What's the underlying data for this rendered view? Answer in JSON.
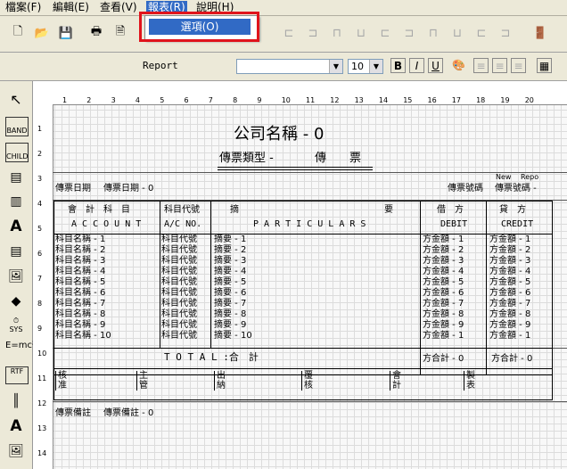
{
  "menu": [
    "檔案(F)",
    "編輯(E)",
    "查看(V)",
    "報表(R)",
    "說明(H)"
  ],
  "dropdown_option": "選項(O)",
  "toolbar2": {
    "report_label": "Report",
    "font_size": "10",
    "bold": "B",
    "italic": "I",
    "underline": "U"
  },
  "tools": [
    "BAND",
    "CHILD",
    "SYS",
    "E=mc²",
    "RTF"
  ],
  "ruler_h": [
    "1",
    "2",
    "3",
    "4",
    "5",
    "6",
    "7",
    "8",
    "9",
    "10",
    "11",
    "12",
    "13",
    "14",
    "15",
    "16",
    "17",
    "18",
    "19",
    "20"
  ],
  "ruler_v": [
    "1",
    "2",
    "3",
    "4",
    "5",
    "6",
    "7",
    "8",
    "9",
    "10",
    "11",
    "12",
    "13",
    "14"
  ],
  "report": {
    "company": "公司名稱 - 0",
    "voucher_type": "傳票類型 - ",
    "voucher_word": "傳　　票",
    "new_label": "New",
    "repo_label": "Repo",
    "date_label": "傳票日期",
    "date_value": "傳票日期 - 0",
    "no_label": "傳票號碼",
    "no_value": "傳票號碼 -",
    "h_account_cn": "會　計　科　目",
    "h_account_en": "A C C O U N T",
    "h_code_cn": "科目代號",
    "h_code_en": "A/C NO.",
    "h_part_cn1": "摘",
    "h_part_cn2": "要",
    "h_part_en": "P A R T I C U L A R S",
    "h_debit_cn": "借　方",
    "h_debit_en": "DEBIT",
    "h_credit_cn": "貸　方",
    "h_credit_en": "CREDIT",
    "rows": [
      {
        "acc": "科目名稱 - 1",
        "code": "科目代號",
        "part": "摘要 - 1",
        "debit": "方金額 - 1",
        "credit": "方金額 - 1"
      },
      {
        "acc": "科目名稱 - 2",
        "code": "科目代號",
        "part": "摘要 - 2",
        "debit": "方金額 - 2",
        "credit": "方金額 - 2"
      },
      {
        "acc": "科目名稱 - 3",
        "code": "科目代號",
        "part": "摘要 - 3",
        "debit": "方金額 - 3",
        "credit": "方金額 - 3"
      },
      {
        "acc": "科目名稱 - 4",
        "code": "科目代號",
        "part": "摘要 - 4",
        "debit": "方金額 - 4",
        "credit": "方金額 - 4"
      },
      {
        "acc": "科目名稱 - 5",
        "code": "科目代號",
        "part": "摘要 - 5",
        "debit": "方金額 - 5",
        "credit": "方金額 - 5"
      },
      {
        "acc": "科目名稱 - 6",
        "code": "科目代號",
        "part": "摘要 - 6",
        "debit": "方金額 - 6",
        "credit": "方金額 - 6"
      },
      {
        "acc": "科目名稱 - 7",
        "code": "科目代號",
        "part": "摘要 - 7",
        "debit": "方金額 - 7",
        "credit": "方金額 - 7"
      },
      {
        "acc": "科目名稱 - 8",
        "code": "科目代號",
        "part": "摘要 - 8",
        "debit": "方金額 - 8",
        "credit": "方金額 - 8"
      },
      {
        "acc": "科目名稱 - 9",
        "code": "科目代號",
        "part": "摘要 - 9",
        "debit": "方金額 - 9",
        "credit": "方金額 - 9"
      },
      {
        "acc": "科目名稱 - 10",
        "code": "科目代號",
        "part": "摘要 - 10",
        "debit": "方金額 - 1",
        "credit": "方金額 - 1"
      }
    ],
    "total_label": "T O T A L :合　計",
    "total_debit": "方合計 - 0",
    "total_credit": "方合計 - 0",
    "sign": [
      "核准",
      "主管",
      "出納",
      "覆核",
      "會計",
      "製表"
    ],
    "remark_label": "傳票備註",
    "remark_value": "傳票備註 - 0"
  }
}
